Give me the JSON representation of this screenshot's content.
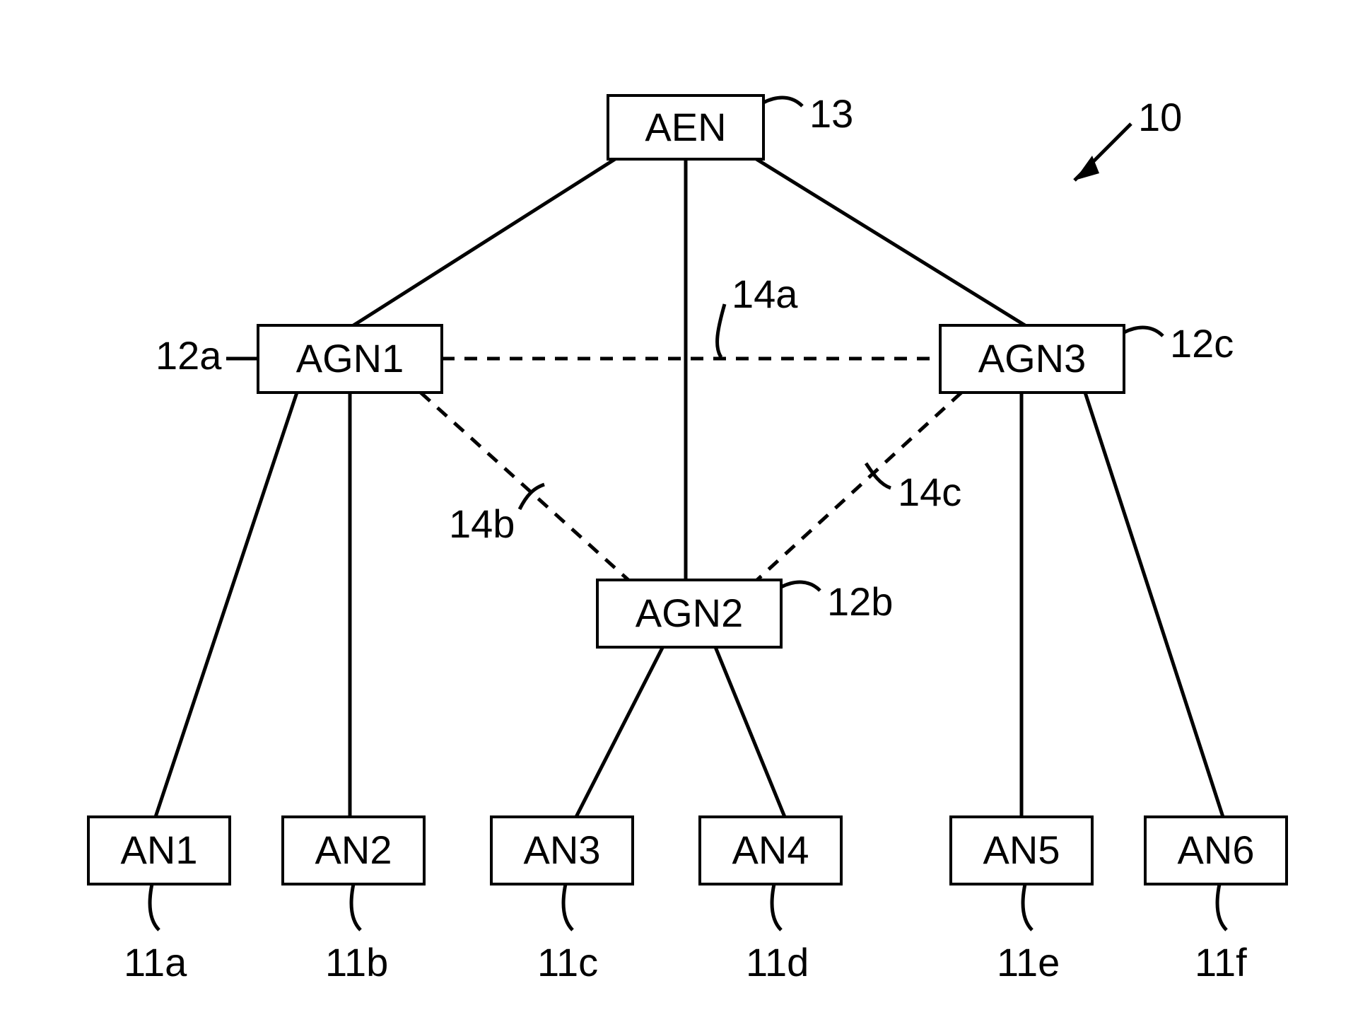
{
  "diagram": {
    "id_label": "10",
    "nodes": {
      "aen": {
        "label": "AEN",
        "ref": "13"
      },
      "agn1": {
        "label": "AGN1",
        "ref": "12a"
      },
      "agn2": {
        "label": "AGN2",
        "ref": "12b"
      },
      "agn3": {
        "label": "AGN3",
        "ref": "12c"
      },
      "an1": {
        "label": "AN1",
        "ref": "11a"
      },
      "an2": {
        "label": "AN2",
        "ref": "11b"
      },
      "an3": {
        "label": "AN3",
        "ref": "11c"
      },
      "an4": {
        "label": "AN4",
        "ref": "11d"
      },
      "an5": {
        "label": "AN5",
        "ref": "11e"
      },
      "an6": {
        "label": "AN6",
        "ref": "11f"
      }
    },
    "links": {
      "l14a": {
        "ref": "14a"
      },
      "l14b": {
        "ref": "14b"
      },
      "l14c": {
        "ref": "14c"
      }
    }
  }
}
